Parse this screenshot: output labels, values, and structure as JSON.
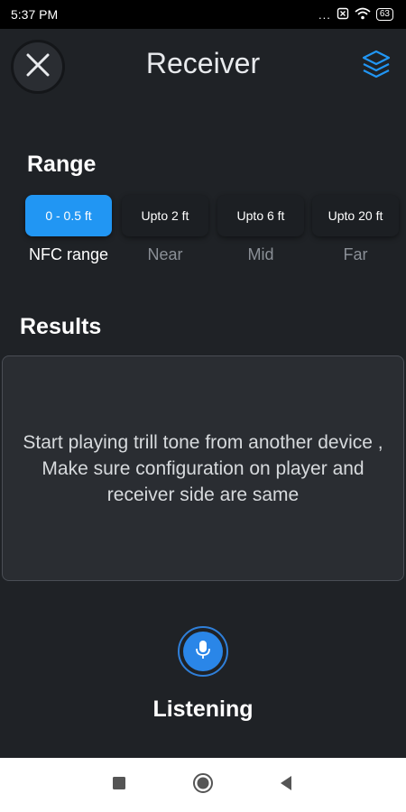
{
  "status_bar": {
    "time": "5:37 PM",
    "dots": "...",
    "battery": "63"
  },
  "header": {
    "title": "Receiver"
  },
  "range": {
    "title": "Range",
    "options": [
      {
        "chip": "0 - 0.5 ft",
        "label": "NFC range",
        "selected": true
      },
      {
        "chip": "Upto 2 ft",
        "label": "Near",
        "selected": false
      },
      {
        "chip": "Upto 6 ft",
        "label": "Mid",
        "selected": false
      },
      {
        "chip": "Upto 20 ft",
        "label": "Far",
        "selected": false
      }
    ]
  },
  "results": {
    "title": "Results",
    "message": "Start playing trill tone from another device , Make sure configuration on player and receiver side are same"
  },
  "listening": {
    "label": "Listening"
  },
  "colors": {
    "accent": "#2196f3",
    "background": "#1f2226",
    "panel": "#2a2d32"
  },
  "icons": [
    "close-icon",
    "layers-icon",
    "microphone-icon",
    "recent-apps-icon",
    "home-icon",
    "back-icon",
    "wifi-icon",
    "battery-icon"
  ]
}
